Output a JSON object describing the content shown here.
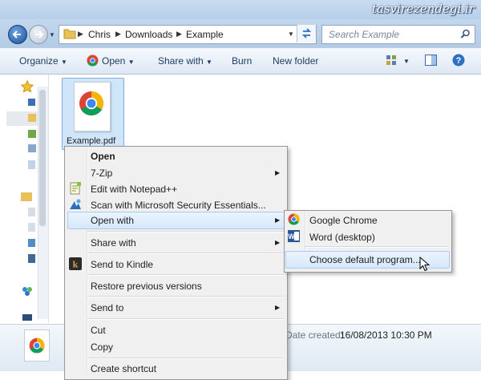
{
  "watermark": "tasvirezendegi.ir",
  "address": {
    "crumbs": [
      "Chris",
      "Downloads",
      "Example"
    ],
    "search_placeholder": "Search Example"
  },
  "toolbar": {
    "organize": "Organize",
    "open": "Open",
    "share_with": "Share with",
    "burn": "Burn",
    "new_folder": "New folder"
  },
  "file": {
    "name": "Example.pdf"
  },
  "context_menu": {
    "items": [
      "Open",
      "7-Zip",
      "Edit with Notepad++",
      "Scan with Microsoft Security Essentials...",
      "Open with",
      "Share with",
      "Send to Kindle",
      "Restore previous versions",
      "Send to",
      "Cut",
      "Copy",
      "Create shortcut"
    ]
  },
  "open_with_submenu": {
    "items": [
      "Google Chrome",
      "Word (desktop)",
      "Choose default program..."
    ]
  },
  "details": {
    "date_created_label": "Date created:",
    "date_created_value": "16/08/2013 10:30 PM"
  },
  "colors": {
    "selection_fill": "#cfe5fa",
    "menu_highlight": "#d6e8fb",
    "chrome_red": "#db4437",
    "chrome_green": "#0f9d58",
    "chrome_yellow": "#f4b400",
    "chrome_blue": "#4285f4"
  }
}
